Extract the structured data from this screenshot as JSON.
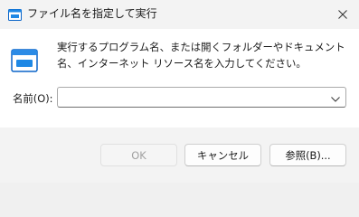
{
  "window": {
    "title": "ファイル名を指定して実行"
  },
  "content": {
    "description": "実行するプログラム名、または開くフォルダーやドキュメント名、インターネット リソース名を入力してください。",
    "open_label": "名前(O):",
    "open_value": "",
    "open_placeholder": ""
  },
  "buttons": {
    "ok": "OK",
    "cancel": "キャンセル",
    "browse": "参照(B)..."
  },
  "colors": {
    "accent": "#0078d4",
    "disabled_text": "#a0a0a0"
  },
  "icons": {
    "title": "run-icon",
    "app": "run-app-icon",
    "close": "close-icon",
    "dropdown": "chevron-down-icon"
  }
}
